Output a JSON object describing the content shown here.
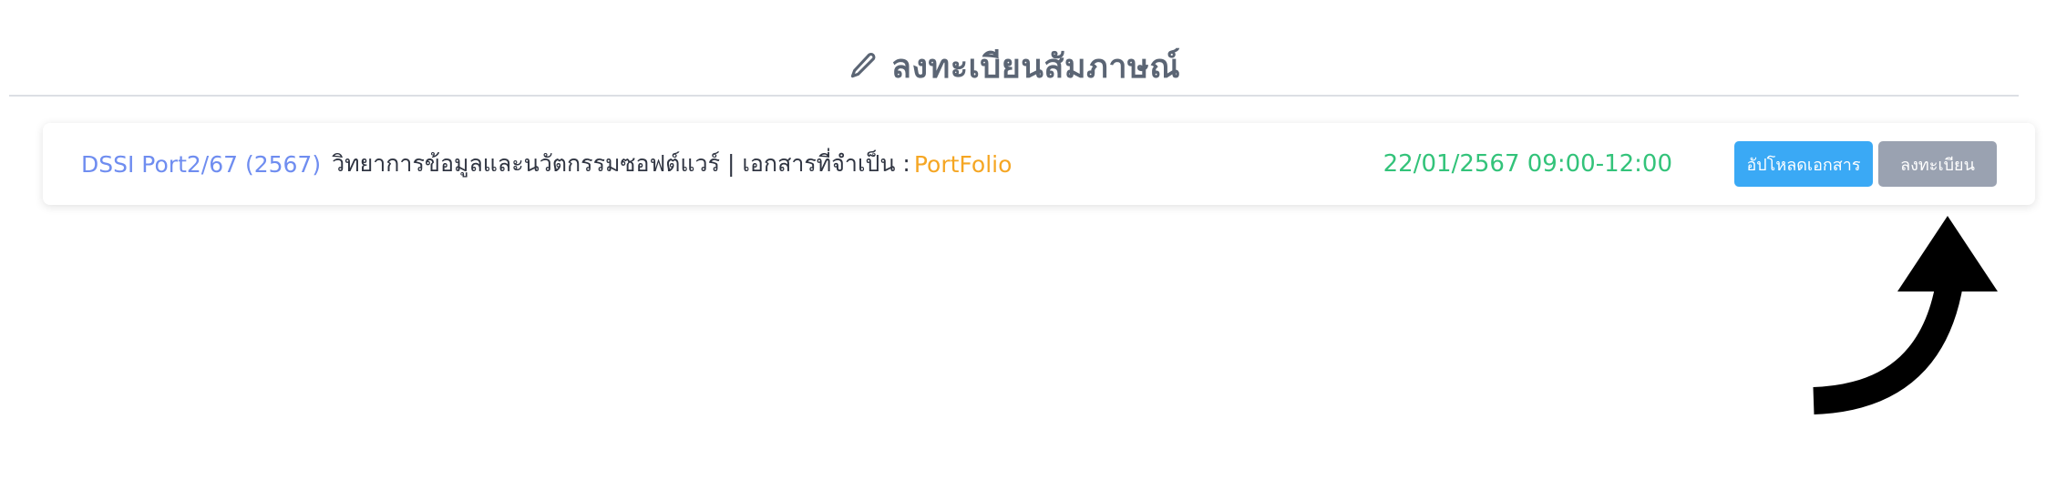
{
  "page": {
    "title": "ลงทะเบียนสัมภาษณ์",
    "title_icon": "pencil-icon"
  },
  "row": {
    "course_code": "DSSI Port2/67 (2567)",
    "course_name": "วิทยาการข้อมูลและนวัตกรรมซอฟต์แวร์ |",
    "docs_label": "เอกสารที่จำเป็น :",
    "docs_value": "PortFolio",
    "datetime": "22/01/2567 09:00-12:00",
    "upload_button": "อัปโหลดเอกสาร",
    "register_button": "ลงทะเบียน"
  },
  "colors": {
    "course_code": "#6f8df0",
    "docs_value": "#f5a623",
    "datetime": "#33c37a",
    "upload_button": "#3aa9f5",
    "register_button": "#9aa2b1"
  }
}
